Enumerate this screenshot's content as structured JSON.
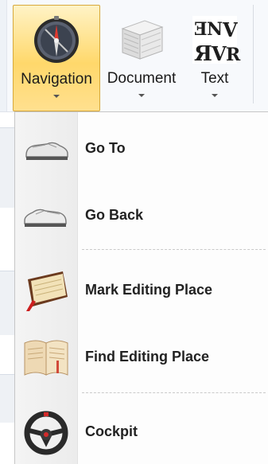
{
  "ribbon": {
    "buttons": [
      {
        "label": "Navigation",
        "icon": "compass-icon",
        "active": true
      },
      {
        "label": "Document",
        "icon": "document-stack-icon",
        "active": false
      },
      {
        "label": "Text",
        "icon": "text-letters-icon",
        "active": false
      }
    ],
    "active_color": "#ffd86b"
  },
  "menu": {
    "items": [
      {
        "label": "Go To",
        "icon": "shoe-icon"
      },
      {
        "label": "Go Back",
        "icon": "shoe-back-icon"
      },
      {
        "label": "Mark Editing Place",
        "icon": "book-bookmark-icon"
      },
      {
        "label": "Find Editing Place",
        "icon": "open-book-icon"
      },
      {
        "label": "Cockpit",
        "icon": "steering-wheel-icon"
      }
    ]
  }
}
